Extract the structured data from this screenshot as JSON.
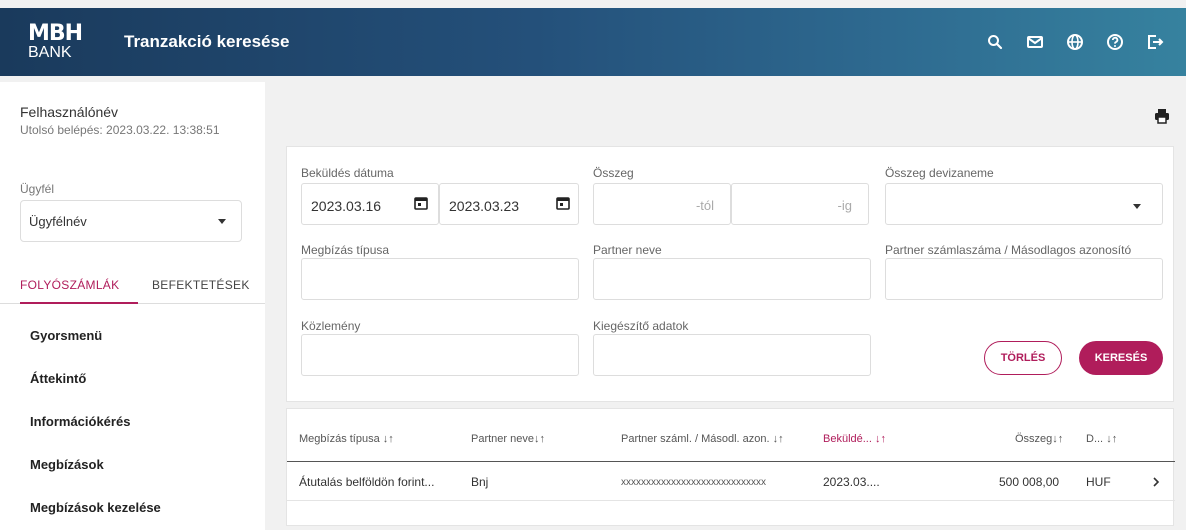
{
  "header": {
    "logo_mark": "MBH",
    "logo_sub": "BANK",
    "title": "Tranzakció keresése",
    "icons": [
      "search-icon",
      "mail-icon",
      "globe-icon",
      "help-icon",
      "logout-icon"
    ]
  },
  "sidebar": {
    "user_name": "Felhasználónév",
    "last_login": "Utolsó belépés: 2023.03.22. 13:38:51",
    "client_label": "Ügyfél",
    "client_value": "Ügyfélnév",
    "tabs": [
      "FOLYÓSZÁMLÁK",
      "BEFEKTETÉSEK"
    ],
    "menu": [
      "Gyorsmenü",
      "Áttekintő",
      "Információkérés",
      "Megbízások",
      "Megbízások kezelése"
    ]
  },
  "form": {
    "send_date_label": "Beküldés dátuma",
    "date_from": "2023.03.16",
    "date_to": "2023.03.23",
    "amount_label": "Összeg",
    "amount_from_placeholder": "-tól",
    "amount_to_placeholder": "-ig",
    "currency_label": "Összeg devizaneme",
    "order_type_label": "Megbízás típusa",
    "partner_name_label": "Partner neve",
    "partner_account_label": "Partner számlaszáma / Másodlagos azonosító",
    "remark_label": "Közlemény",
    "extra_label": "Kiegészítő adatok",
    "clear_button": "TÖRLÉS",
    "search_button": "KERESÉS"
  },
  "table": {
    "columns": [
      "Megbízás típusa",
      "Partner neve",
      "Partner száml. / Másodl. azon.",
      "Beküldé...",
      "Összeg",
      "D..."
    ],
    "rows": [
      [
        "Átutalás belföldön forint...",
        "Bnj",
        "xxxxxxxxxxxxxxxxxxxxxxxxxxxxx",
        "2023.03....",
        "500 008,00",
        "HUF"
      ]
    ]
  },
  "colors": {
    "accent": "#b01d5b",
    "header_start": "#1a3a5c",
    "header_end": "#36829f"
  }
}
